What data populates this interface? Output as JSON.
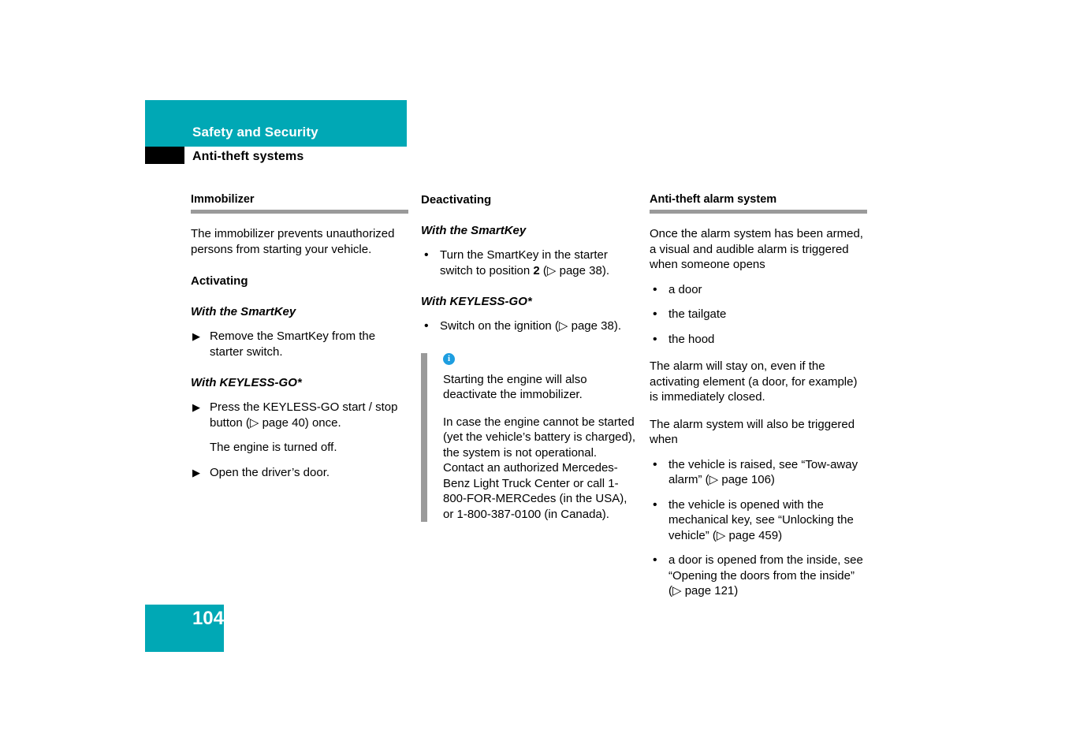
{
  "header": {
    "chapter": "Safety and Security",
    "section": "Anti-theft systems"
  },
  "colors": {
    "accent_teal": "#00a8b5",
    "rule_grey": "#9a9a9a",
    "info_blue": "#1e9ee0",
    "tab_black": "#000000"
  },
  "column_left": {
    "heading": "Immobilizer",
    "intro": "The immobilizer prevents unauthorized persons from starting your vehicle.",
    "activating_heading": "Activating",
    "smartkey_heading": "With the SmartKey",
    "smartkey_steps": [
      {
        "marker": "▶",
        "text": "Remove the SmartKey from the starter switch."
      }
    ],
    "keyless_heading": "With KEYLESS-GO*",
    "keyless_steps": [
      {
        "marker": "▶",
        "text": "Press the KEYLESS-GO start / stop button (▷ page 40) once.",
        "sub": "The engine is turned off."
      },
      {
        "marker": "▶",
        "text": "Open the driver’s door."
      }
    ]
  },
  "column_middle": {
    "heading": "Deactivating",
    "smartkey_heading": "With the SmartKey",
    "smartkey_steps": [
      {
        "marker": "•",
        "text_before": "Turn the SmartKey in the starter switch to position ",
        "bold": "2",
        "text_after": " (▷ page 38)."
      }
    ],
    "keyless_heading": "With KEYLESS-GO*",
    "keyless_steps": [
      {
        "marker": "•",
        "text": "Switch on the ignition (▷ page 38)."
      }
    ],
    "note": {
      "icon": "info-icon",
      "icon_glyph": "i",
      "paragraphs": [
        "Starting the engine will also deactivate the immobilizer.",
        "In case the engine cannot be started (yet the vehicle’s battery is charged), the system is not operational. Contact an authorized Mercedes-Benz Light Truck Center or call 1-800-FOR-MERCedes (in the USA), or 1-800-387-0100 (in Canada)."
      ]
    }
  },
  "column_right": {
    "heading": "Anti-theft alarm system",
    "intro": "Once the alarm system has been armed, a visual and audible alarm is triggered when someone opens",
    "opens_list": [
      {
        "marker": "•",
        "text": "a door"
      },
      {
        "marker": "•",
        "text": "the tailgate"
      },
      {
        "marker": "•",
        "text": "the hood"
      }
    ],
    "stay_on_paragraph": "The alarm will stay on, even if the activating element (a door, for example) is immediately closed.",
    "triggered_paragraph": "The alarm system will also be triggered when",
    "triggered_list": [
      {
        "marker": "•",
        "text": "the vehicle is raised, see “Tow-away alarm” (▷ page 106)"
      },
      {
        "marker": "•",
        "text": "the vehicle is opened with the mechanical key, see “Unlocking the vehicle” (▷ page 459)"
      },
      {
        "marker": "•",
        "text": "a door is opened from the inside, see “Opening the doors from the inside” (▷ page 121)"
      }
    ]
  },
  "footer": {
    "page_number": "104"
  }
}
